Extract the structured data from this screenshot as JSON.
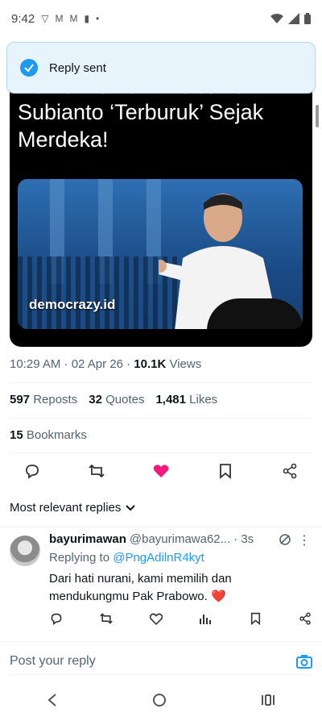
{
  "status": {
    "time": "9:42"
  },
  "toast": {
    "message": "Reply sent",
    "icon": "check-circle-icon"
  },
  "tweet": {
    "headline_cut": "Pemerintahan Prabowo",
    "headline": "Subianto ‘Terburuk’ Sejak Merdeka!",
    "image_watermark": "democrazy.id",
    "timestamp": "10:29 AM · 02 Apr 26 · ",
    "views_count": "10.1K",
    "views_label": " Views",
    "reposts_count": "597",
    "reposts_label": " Reposts",
    "quotes_count": "32",
    "quotes_label": " Quotes",
    "likes_count": "1,481",
    "likes_label": " Likes",
    "bookmarks_count": "15",
    "bookmarks_label": " Bookmarks",
    "liked": true
  },
  "replies_sort": {
    "label": "Most relevant replies"
  },
  "reply": {
    "name": "bayurimawan",
    "handle": "@bayurimawa62...",
    "time": "· 3s",
    "replying_prefix": "Replying to ",
    "replying_to": "@PngAdilnR4kyt",
    "text": "Dari hati nurani, kami memilih dan mendukungmu Pak Prabowo. ❤️"
  },
  "compose": {
    "placeholder": "Post your reply"
  },
  "colors": {
    "accent": "#1d9bf0",
    "like": "#f91880",
    "toast_bg": "#e8f4fb"
  }
}
